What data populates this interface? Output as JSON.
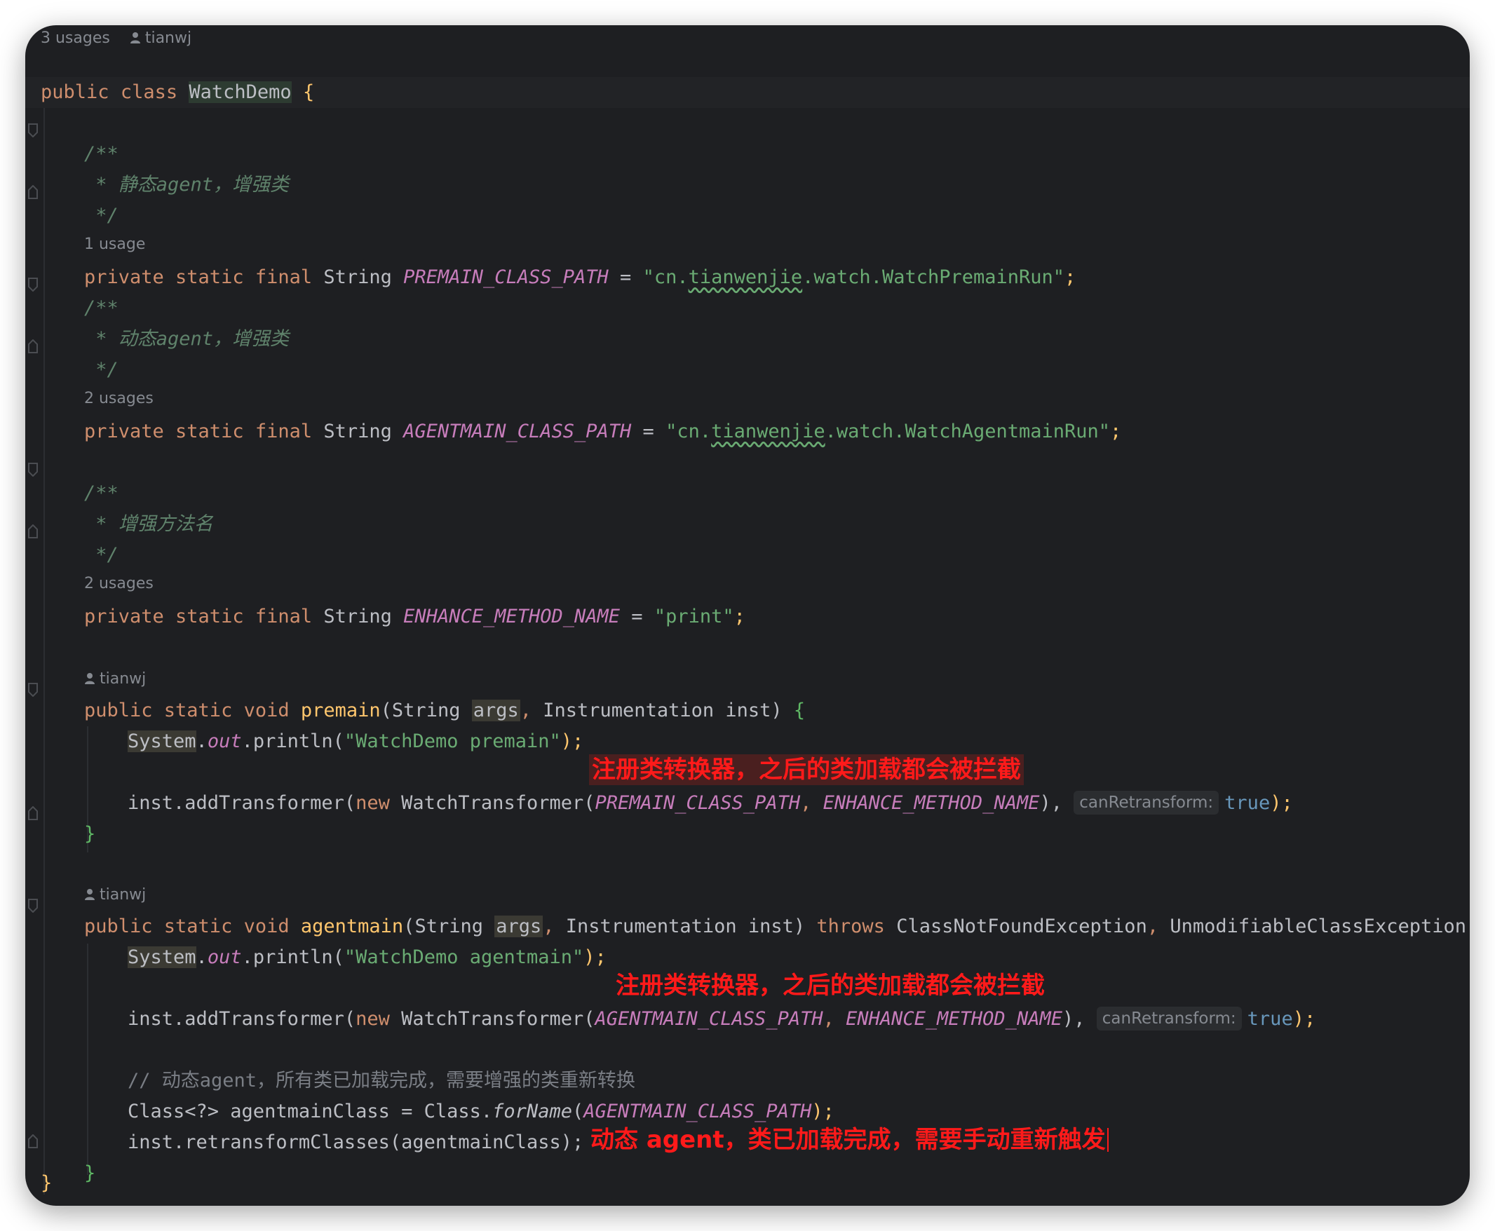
{
  "hints": {
    "class_usages": "3 usages",
    "author": "tianwj",
    "premain_usages": "1 usage",
    "agentmain_usages": "2 usages",
    "method_usages": "2 usages"
  },
  "code": {
    "class_line": {
      "kw1": "public",
      "kw2": "class",
      "name": "WatchDemo",
      "brace": "{"
    },
    "doc1": {
      "open": "/**",
      "body": " * 静态agent，增强类",
      "close": " */"
    },
    "field1": {
      "mods": "private static final ",
      "type": "String ",
      "name": "PREMAIN_CLASS_PATH",
      "eq": " = ",
      "str_pre": "\"cn.",
      "str_sq": "tianwenjie",
      "str_post": ".watch.WatchPremainRun\"",
      "semi": ";"
    },
    "doc2": {
      "open": "/**",
      "body": " * 动态agent，增强类",
      "close": " */"
    },
    "field2": {
      "mods": "private static final ",
      "type": "String ",
      "name": "AGENTMAIN_CLASS_PATH",
      "eq": " = ",
      "str_pre": "\"cn.",
      "str_sq": "tianwenjie",
      "str_post": ".watch.WatchAgentmainRun\"",
      "semi": ";"
    },
    "doc3": {
      "open": "/**",
      "body": " * 增强方法名",
      "close": " */"
    },
    "field3": {
      "mods": "private static final ",
      "type": "String ",
      "name": "ENHANCE_METHOD_NAME",
      "eq": " = ",
      "str": "\"print\"",
      "semi": ";"
    },
    "premain_sig": {
      "mods": "public static void ",
      "name": "premain",
      "open": "(",
      "t1": "String ",
      "p1": "args",
      "comma": ", ",
      "t2": "Instrumentation inst",
      "close": ") ",
      "brace": "{"
    },
    "premain_print": {
      "sys": "System",
      "dot": ".",
      "out": "out",
      "call": ".println(",
      "str": "\"WatchDemo premain\"",
      "end": ");"
    },
    "premain_add": {
      "pre": "inst.addTransformer(",
      "kw": "new ",
      "cls": "WatchTransformer(",
      "a1": "PREMAIN_CLASS_PATH",
      "c1": ", ",
      "a2": "ENHANCE_METHOD_NAME",
      "c2": "), ",
      "hint": "canRetransform:",
      "val": "true",
      "end": ");"
    },
    "close_brace": "}",
    "agentmain_sig": {
      "mods": "public static void ",
      "name": "agentmain",
      "open": "(",
      "t1": "String ",
      "p1": "args",
      "comma": ", ",
      "t2": "Instrumentation inst",
      "close": ") ",
      "throws": "throws ",
      "e1": "ClassNotFoundException",
      "c": ", ",
      "e2": "UnmodifiableClassException",
      "brace": " {"
    },
    "agentmain_print": {
      "sys": "System",
      "dot": ".",
      "out": "out",
      "call": ".println(",
      "str": "\"WatchDemo agentmain\"",
      "end": ");"
    },
    "agentmain_add": {
      "pre": "inst.addTransformer(",
      "kw": "new ",
      "cls": "WatchTransformer(",
      "a1": "AGENTMAIN_CLASS_PATH",
      "c1": ", ",
      "a2": "ENHANCE_METHOD_NAME",
      "c2": "), ",
      "hint": "canRetransform:",
      "val": "true",
      "end": ");"
    },
    "line_comment": "// 动态agent，所有类已加载完成，需要增强的类重新转换",
    "forname": {
      "pre": "Class<?> agentmainClass = Class.",
      "fn": "forName",
      "open": "(",
      "arg": "AGENTMAIN_CLASS_PATH",
      "end": ");"
    },
    "retransform": "inst.retransformClasses(agentmainClass);",
    "class_close": "}"
  },
  "annotations": {
    "a1": "注册类转换器，之后的类加载都会被拦截",
    "a2": "注册类转换器，之后的类加载都会被拦截",
    "a3": "动态 agent，类已加载完成，需要手动重新触发"
  },
  "colors": {
    "background": "#1e1f22",
    "keyword": "#cf8e6d",
    "string": "#6aab73",
    "constant": "#c77dbb",
    "comment": "#5f826b",
    "annotation": "#ff1a1a"
  }
}
